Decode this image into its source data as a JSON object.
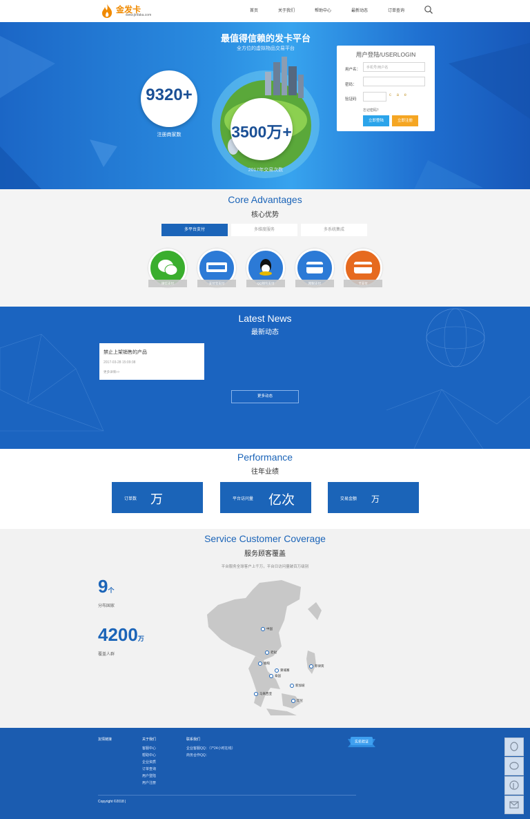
{
  "header": {
    "logo_name": "金发卡",
    "logo_url": "www.jinfaka.com",
    "nav": [
      "首页",
      "关于我们",
      "帮助中心",
      "最新动态",
      "订单查询"
    ]
  },
  "hero": {
    "title": "最值得信赖的发卡平台",
    "subtitle": "全方位的虚拟物品交易平台",
    "stat1_value": "9320+",
    "stat1_label": "注册商家数",
    "stat2_value": "3500万+",
    "stat2_label": "2017年交易次数"
  },
  "login": {
    "title": "用户登陆/USERLOGIN",
    "username_label": "用户名：",
    "username_placeholder": "手机号/用户名",
    "password_label": "密码：",
    "captcha_label": "验证码",
    "captcha_text": "c a e",
    "forgot": "忘记密码？",
    "login_btn": "立即登陆",
    "register_btn": "立即注册"
  },
  "core": {
    "title_en": "Core Advantages",
    "title_cn": "核心优势",
    "tabs": [
      "多平台支付",
      "多维度服务",
      "多系统集成"
    ],
    "payments": [
      {
        "label": "微信支付",
        "icon": "wechat-icon",
        "color": "#3aae2e"
      },
      {
        "label": "支付宝支付",
        "icon": "alipay-icon",
        "color": "#2c7ad6"
      },
      {
        "label": "QQ钱包支付",
        "icon": "qq-icon",
        "color": "#2c7ad6"
      },
      {
        "label": "网银支付",
        "icon": "bank-card-icon",
        "color": "#2c7ad6"
      },
      {
        "label": "卡支付",
        "icon": "card-icon",
        "color": "#e66a1f"
      }
    ]
  },
  "news": {
    "title_en": "Latest News",
    "title_cn": "最新动态",
    "items": [
      {
        "title": "禁止上架销售的产品",
        "date": "2017-03-28 15:09:38",
        "more": "更多详情>>"
      }
    ],
    "more_btn": "更多动态"
  },
  "performance": {
    "title_en": "Performance",
    "title_cn": "往年业绩",
    "boxes": [
      {
        "label": "订单数",
        "value": "万"
      },
      {
        "label": "平台访问量",
        "value": "亿次"
      },
      {
        "label": "交易金额",
        "value": "万"
      }
    ]
  },
  "coverage": {
    "title_en": "Service Customer Coverage",
    "title_cn": "服务顾客覆盖",
    "subtitle": "平台服务全球客户上千万，平台日访问量破百万级别",
    "stat1_num": "9",
    "stat1_unit": "个",
    "stat1_label": "分布国家",
    "stat2_num": "4200",
    "stat2_unit": "万",
    "stat2_label": "覆盖人群",
    "pins": [
      "中国",
      "老挝",
      "缅甸",
      "柬埔寨",
      "泰国",
      "菲律宾",
      "新加坡",
      "马来西亚",
      "印尼"
    ]
  },
  "footer": {
    "col1_head": "友情链接",
    "col2_head": "关于我们",
    "col2_links": [
      "客服中心",
      "帮助中心",
      "企业资质",
      "订单查询",
      "用户登陆",
      "用户注册"
    ],
    "col3_head": "联系我们",
    "col3_lines": [
      "企业客服QQ：（7*24小时在线）",
      "商务合作QQ："
    ],
    "badge": "实名验证",
    "copyright": "Copyright ©2018 |"
  }
}
